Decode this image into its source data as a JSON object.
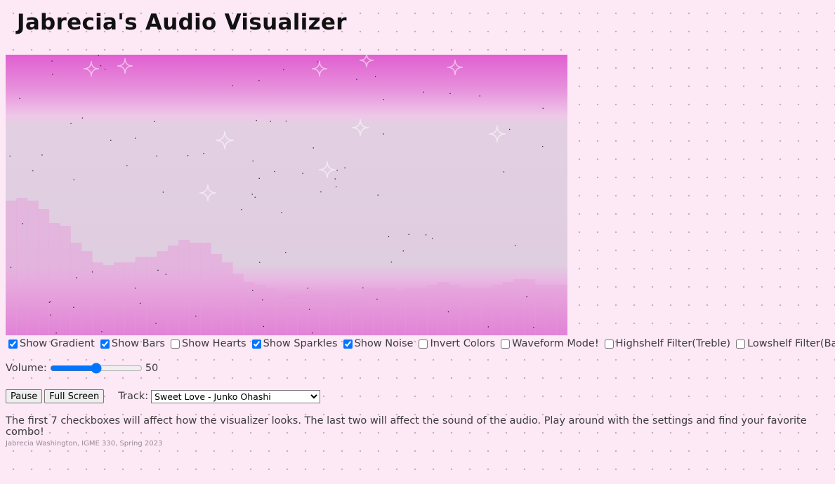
{
  "page": {
    "title": "Jabrecia's Audio Visualizer",
    "description": "The first 7 checkboxes will affect how the visualizer looks. The last two will affect the sound of the audio. Play around with the settings and find your favorite combo!",
    "credit": "Jabrecia Washington, IGME 330, Spring 2023"
  },
  "checkboxes": [
    {
      "id": "gradient",
      "label": "Show Gradient",
      "checked": true
    },
    {
      "id": "bars",
      "label": "Show Bars",
      "checked": true
    },
    {
      "id": "hearts",
      "label": "Show Hearts",
      "checked": false
    },
    {
      "id": "sparkles",
      "label": "Show Sparkles",
      "checked": true
    },
    {
      "id": "noise",
      "label": "Show Noise",
      "checked": true
    },
    {
      "id": "invert",
      "label": "Invert Colors",
      "checked": false
    },
    {
      "id": "waveform",
      "label": "Waveform Mode!",
      "checked": false
    },
    {
      "id": "highshelf",
      "label": "Highshelf Filter(Treble)",
      "checked": false
    },
    {
      "id": "lowshelf",
      "label": "Lowshelf Filter(Bass)",
      "checked": false
    }
  ],
  "volume": {
    "label": "Volume:",
    "value": 50,
    "display": "50"
  },
  "buttons": {
    "pause": "Pause",
    "fullscreen": "Full Screen"
  },
  "track": {
    "label": "Track:",
    "selected": "Sweet Love - Junko Ohashi"
  },
  "colors": {
    "background": "#fde8f6",
    "gradient_edge": "#e05fd0",
    "gradient_mid": "#dfcde0",
    "bars": "#e6a3dc"
  },
  "visualizer": {
    "bar_levels": [
      0.48,
      0.49,
      0.48,
      0.45,
      0.4,
      0.39,
      0.33,
      0.3,
      0.26,
      0.25,
      0.26,
      0.26,
      0.28,
      0.28,
      0.3,
      0.32,
      0.34,
      0.33,
      0.33,
      0.29,
      0.26,
      0.22,
      0.19,
      0.18,
      0.17,
      0.15,
      0.13,
      0.14,
      0.14,
      0.14,
      0.14,
      0.15,
      0.16,
      0.17,
      0.17,
      0.17,
      0.16,
      0.17,
      0.17,
      0.18,
      0.19,
      0.18,
      0.17,
      0.17,
      0.17,
      0.18,
      0.19,
      0.2,
      0.2,
      0.18,
      0.18,
      0.18
    ]
  }
}
